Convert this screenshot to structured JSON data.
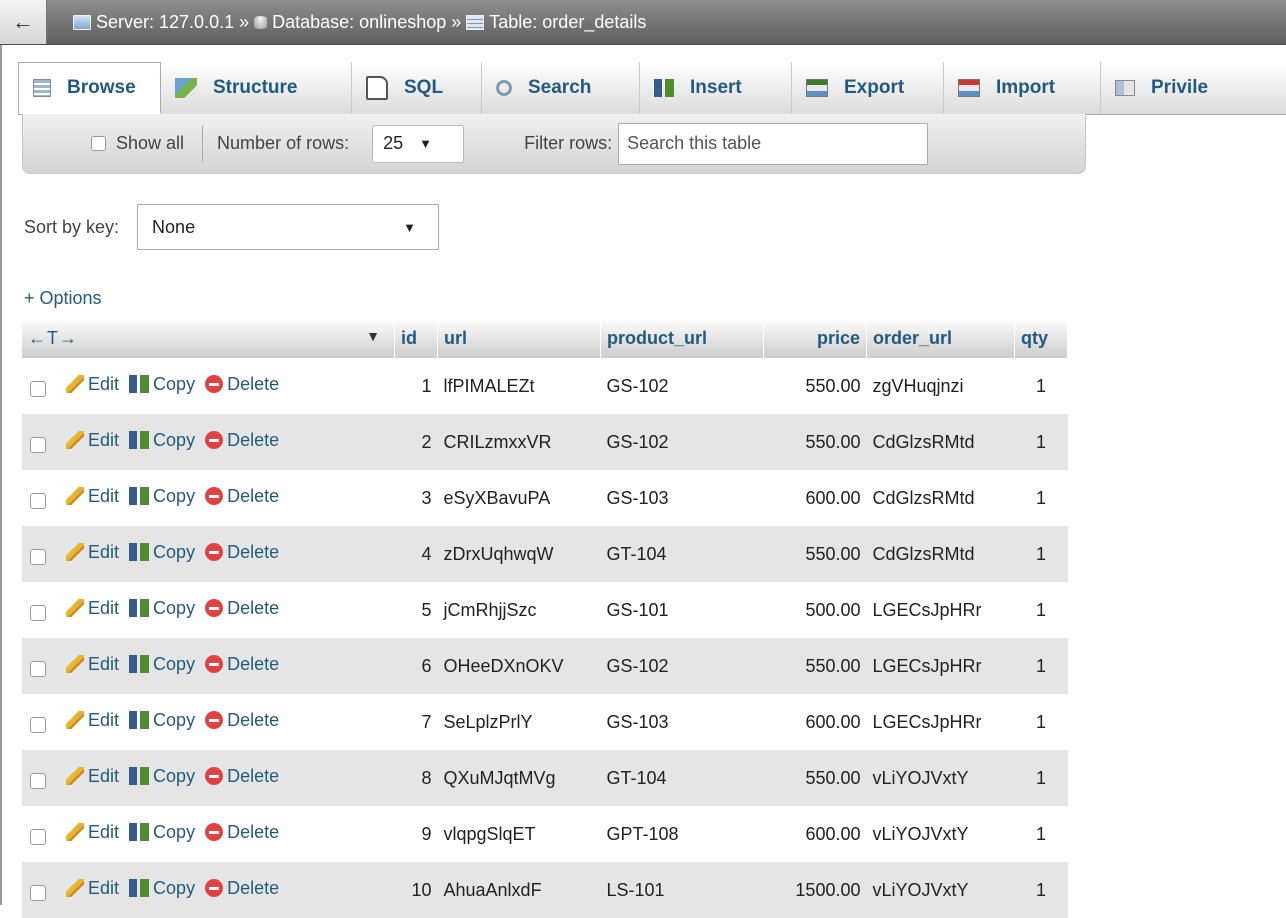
{
  "breadcrumb": {
    "back_label": "←",
    "server": "Server: 127.0.0.1",
    "database": "Database: onlineshop",
    "table": "Table: order_details",
    "separator": "»"
  },
  "tabs": [
    {
      "label": "Browse",
      "icon": "browse-icon",
      "active": true
    },
    {
      "label": "Structure",
      "icon": "structure-icon"
    },
    {
      "label": "SQL",
      "icon": "sql-icon"
    },
    {
      "label": "Search",
      "icon": "search-icon"
    },
    {
      "label": "Insert",
      "icon": "insert-icon"
    },
    {
      "label": "Export",
      "icon": "export-icon"
    },
    {
      "label": "Import",
      "icon": "import-icon"
    },
    {
      "label": "Privile",
      "icon": "privileges-icon"
    }
  ],
  "filter": {
    "show_all": "Show all",
    "rows_label": "Number of rows:",
    "rows_value": "25",
    "filter_label": "Filter rows:",
    "search_placeholder": "Search this table"
  },
  "sort": {
    "label": "Sort by key:",
    "value": "None"
  },
  "options_label": "+ Options",
  "table": {
    "arrows": "←T→",
    "columns": [
      "id",
      "url",
      "product_url",
      "price",
      "order_url",
      "qty"
    ],
    "actions": {
      "edit": "Edit",
      "copy": "Copy",
      "delete": "Delete"
    },
    "rows": [
      {
        "id": "1",
        "url": "lfPIMALEZt",
        "product_url": "GS-102",
        "price": "550.00",
        "order_url": "zgVHuqjnzi",
        "qty": "1"
      },
      {
        "id": "2",
        "url": "CRILzmxxVR",
        "product_url": "GS-102",
        "price": "550.00",
        "order_url": "CdGlzsRMtd",
        "qty": "1"
      },
      {
        "id": "3",
        "url": "eSyXBavuPA",
        "product_url": "GS-103",
        "price": "600.00",
        "order_url": "CdGlzsRMtd",
        "qty": "1"
      },
      {
        "id": "4",
        "url": "zDrxUqhwqW",
        "product_url": "GT-104",
        "price": "550.00",
        "order_url": "CdGlzsRMtd",
        "qty": "1"
      },
      {
        "id": "5",
        "url": "jCmRhjjSzc",
        "product_url": "GS-101",
        "price": "500.00",
        "order_url": "LGECsJpHRr",
        "qty": "1"
      },
      {
        "id": "6",
        "url": "OHeeDXnOKV",
        "product_url": "GS-102",
        "price": "550.00",
        "order_url": "LGECsJpHRr",
        "qty": "1"
      },
      {
        "id": "7",
        "url": "SeLplzPrlY",
        "product_url": "GS-103",
        "price": "600.00",
        "order_url": "LGECsJpHRr",
        "qty": "1"
      },
      {
        "id": "8",
        "url": "QXuMJqtMVg",
        "product_url": "GT-104",
        "price": "550.00",
        "order_url": "vLiYOJVxtY",
        "qty": "1"
      },
      {
        "id": "9",
        "url": "vlqpgSlqET",
        "product_url": "GPT-108",
        "price": "600.00",
        "order_url": "vLiYOJVxtY",
        "qty": "1"
      },
      {
        "id": "10",
        "url": "AhuaAnlxdF",
        "product_url": "LS-101",
        "price": "1500.00",
        "order_url": "vLiYOJVxtY",
        "qty": "1"
      }
    ]
  },
  "colors": {
    "link": "#235a81",
    "row_alt": "#e5e5e5",
    "topbar": "#5e5e5e"
  }
}
